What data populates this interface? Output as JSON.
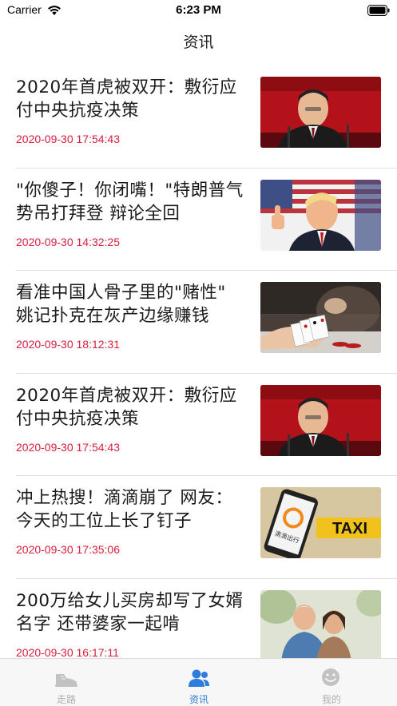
{
  "status_bar": {
    "carrier": "Carrier",
    "time": "6:23 PM"
  },
  "nav": {
    "title": "资讯"
  },
  "news": [
    {
      "title": "2020年首虎被双开：敷衍应付中央抗疫决策",
      "date": "2020-09-30 17:54:43",
      "image": "speaker-photo"
    },
    {
      "title": "\"你傻子！你闭嘴！\"特朗普气势吊打拜登 辩论全回",
      "date": "2020-09-30 14:32:25",
      "image": "thumbs-up-photo"
    },
    {
      "title": "看准中国人骨子里的\"赌性\" 姚记扑克在灰产边缘赚钱",
      "date": "2020-09-30 18:12:31",
      "image": "playing-cards-photo"
    },
    {
      "title": "2020年首虎被双开：敷衍应付中央抗疫决策",
      "date": "2020-09-30 17:54:43",
      "image": "speaker-photo"
    },
    {
      "title": "冲上热搜！滴滴崩了 网友：今天的工位上长了钉子",
      "date": "2020-09-30 17:35:06",
      "image": "taxi-phone-photo",
      "image_text": {
        "phone": "滴滴出行",
        "sign": "TAXI"
      }
    },
    {
      "title": "200万给女儿买房却写了女婿名字 还带婆家一起啃",
      "date": "2020-09-30 16:17:11",
      "image": "elderly-couple-photo"
    }
  ],
  "tabs": [
    {
      "label": "走路",
      "icon": "shoe-icon",
      "active": false
    },
    {
      "label": "资讯",
      "icon": "people-icon",
      "active": true
    },
    {
      "label": "我的",
      "icon": "smiley-icon",
      "active": false
    }
  ],
  "colors": {
    "accent": "#2f7ddb",
    "date": "#d81e3c",
    "inactive": "#b0b0b0"
  }
}
